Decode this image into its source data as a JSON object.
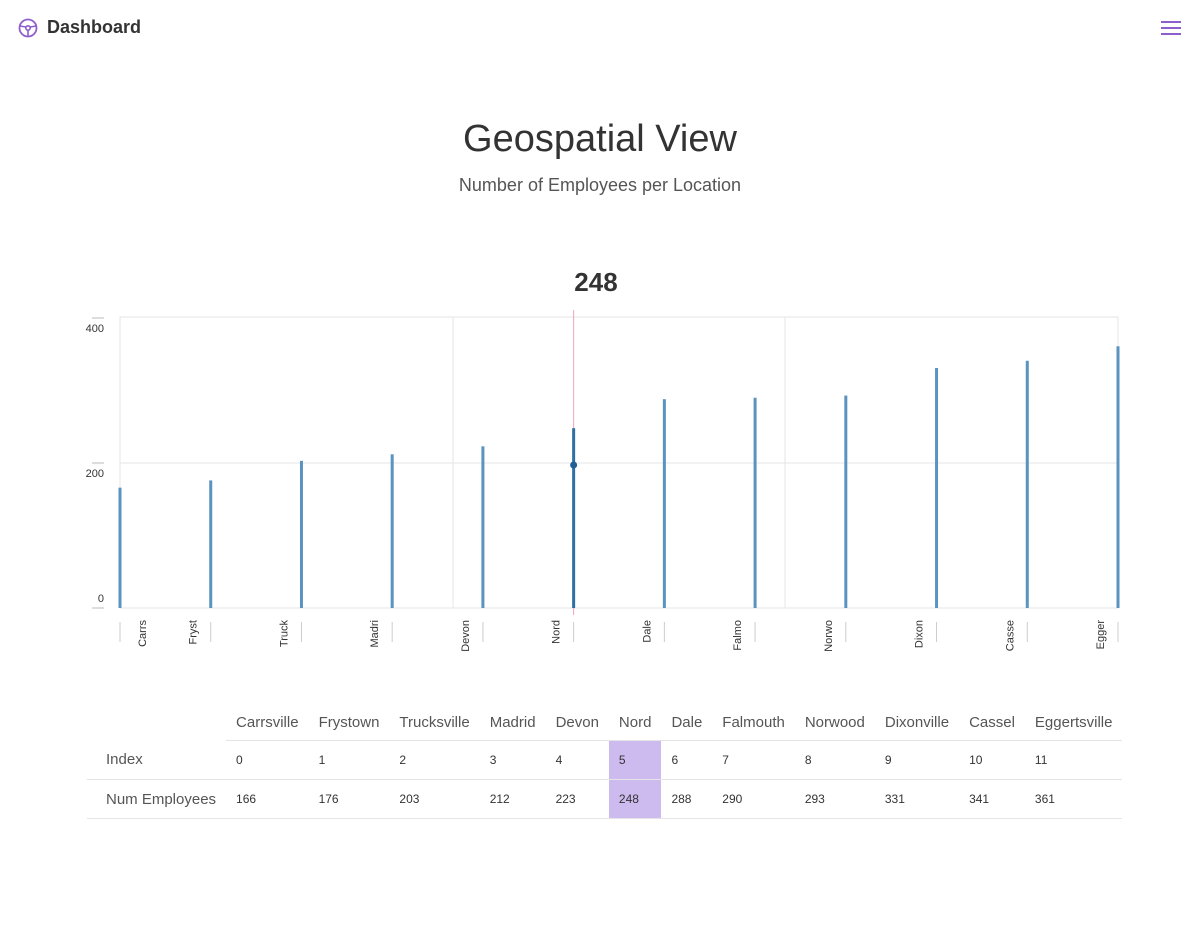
{
  "app": {
    "title": "Dashboard",
    "logo_icon": "steering-wheel-icon",
    "menu_icon": "hamburger-menu-icon"
  },
  "page": {
    "title": "Geospatial View",
    "subtitle": "Number of Employees per Location"
  },
  "selected": {
    "value": "248",
    "index": 5
  },
  "colors": {
    "bar": "#5a93c0",
    "highlight_bar": "#2f6fa3",
    "rule": "#f0a3bf",
    "point": "#1f5f96",
    "accent": "#8e5ecc",
    "cell_highlight": "#cdbaee"
  },
  "chart_data": {
    "type": "bar",
    "categories": [
      "Carrs",
      "Fryst",
      "Truck",
      "Madri",
      "Devon",
      "Nord",
      "Dale",
      "Falmo",
      "Norwo",
      "Dixon",
      "Casse",
      "Egger"
    ],
    "values": [
      166,
      176,
      203,
      212,
      223,
      248,
      288,
      290,
      293,
      331,
      341,
      361
    ],
    "yticks": [
      "0",
      "200",
      "400"
    ],
    "ylim": [
      0,
      400
    ],
    "highlight_index": 5,
    "grid": true
  },
  "table": {
    "columns": [
      "Carrsville",
      "Frystown",
      "Trucksville",
      "Madrid",
      "Devon",
      "Nord",
      "Dale",
      "Falmouth",
      "Norwood",
      "Dixonville",
      "Cassel",
      "Eggertsville"
    ],
    "rows": [
      {
        "label": "Index",
        "values": [
          "0",
          "1",
          "2",
          "3",
          "4",
          "5",
          "6",
          "7",
          "8",
          "9",
          "10",
          "11"
        ]
      },
      {
        "label": "Num Employees",
        "values": [
          "166",
          "176",
          "203",
          "212",
          "223",
          "248",
          "288",
          "290",
          "293",
          "331",
          "341",
          "361"
        ]
      }
    ]
  }
}
